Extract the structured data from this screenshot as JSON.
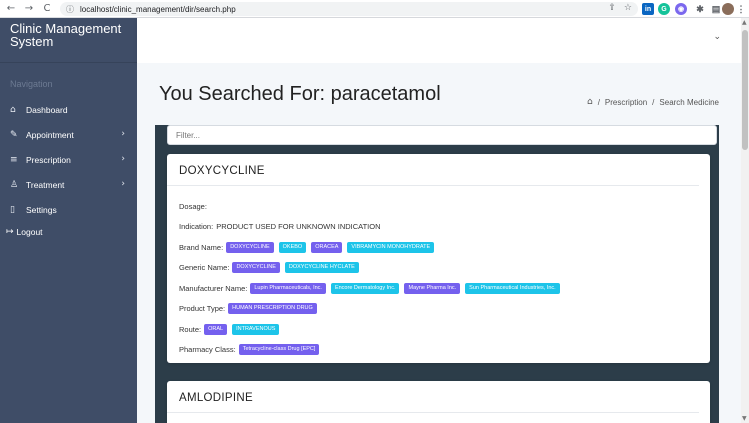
{
  "browser": {
    "url": "localhost/clinic_management/dir/search.php",
    "back_icon": "←",
    "forward_icon": "→",
    "reload_icon": "C",
    "info_icon": "ⓘ"
  },
  "sidebar": {
    "brand": "Clinic Management System",
    "nav_heading": "Navigation",
    "items": [
      {
        "label": "Dashboard",
        "icon": "⌂",
        "chev": ""
      },
      {
        "label": "Appointment",
        "icon": "✎",
        "chev": "›"
      },
      {
        "label": "Prescription",
        "icon": "≡",
        "chev": "›"
      },
      {
        "label": "Treatment",
        "icon": "♙",
        "chev": "›"
      },
      {
        "label": "Settings",
        "icon": "▯",
        "chev": ""
      }
    ],
    "logout": {
      "label": "Logout",
      "icon": "↦"
    }
  },
  "topbar": {
    "chevron": "⌄"
  },
  "main": {
    "title": "You Searched For: paracetamol",
    "breadcrumb": {
      "home_icon": "⌂",
      "sep": "/",
      "items": [
        "Prescription",
        "Search Medicine"
      ]
    },
    "filter_placeholder": "Filter..."
  },
  "results": [
    {
      "name": "DOXYCYCLINE",
      "dosage_label": "Dosage:",
      "indication_label": "Indication:",
      "indication": "PRODUCT USED FOR UNKNOWN INDICATION",
      "brand_label": "Brand Name:",
      "brand": [
        "DOXYCYCLINE",
        "OKEBO",
        "ORACEA",
        "VIBRAMYCIN MONOHYDRATE"
      ],
      "generic_label": "Generic Name:",
      "generic": [
        "DOXYCYCLINE",
        "DOXYCYCLINE HYCLATE"
      ],
      "manufacturer_label": "Manufacturer Name:",
      "manufacturer": [
        "Lupin Pharmaceuticals, Inc.",
        "Encore Dermatology Inc.",
        "Mayne Pharma Inc.",
        "Sun Pharmaceutical Industries, Inc."
      ],
      "product_label": "Product Type:",
      "product": [
        "HUMAN PRESCRIPTION DRUG"
      ],
      "route_label": "Route:",
      "route": [
        "ORAL",
        "INTRAVENOUS"
      ],
      "pharmacy_label": "Pharmacy Class:",
      "pharmacy": [
        "Tetracycline-class Drug [EPC]"
      ]
    },
    {
      "name": "AMLODIPINE"
    }
  ],
  "colors": {
    "sidebar": "#3f4d67",
    "tag_purple": "#7460ee",
    "tag_teal": "#1dc4e9",
    "panel": "#2c3d49"
  }
}
